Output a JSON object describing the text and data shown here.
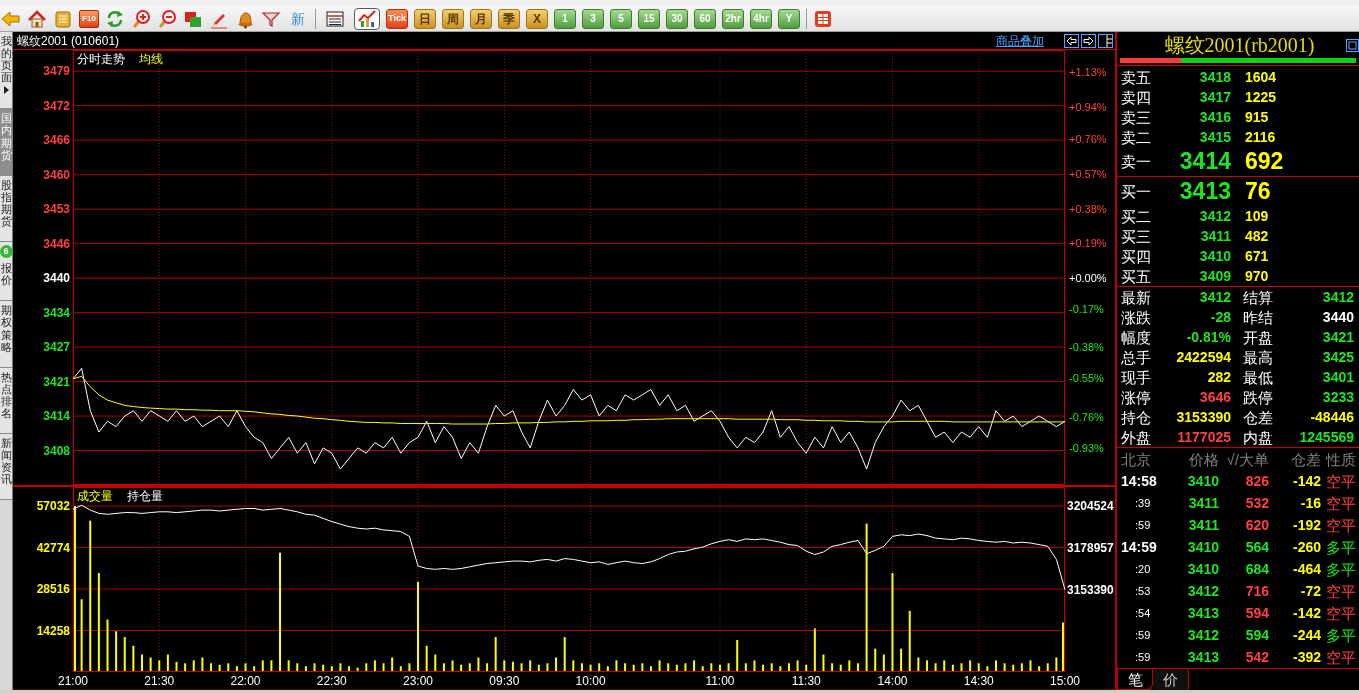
{
  "toolbar": {
    "f10_label": "F10",
    "news_button": "新",
    "views": [
      {
        "selected": false
      },
      {
        "selected": true
      }
    ],
    "periods": [
      {
        "label": "Tick",
        "kind": "tick"
      },
      {
        "label": "日",
        "kind": "calendar"
      },
      {
        "label": "周",
        "kind": "calendar"
      },
      {
        "label": "月",
        "kind": "calendar"
      },
      {
        "label": "季",
        "kind": "calendar"
      },
      {
        "label": "X",
        "kind": "calendar"
      },
      {
        "label": "1",
        "kind": "minute"
      },
      {
        "label": "3",
        "kind": "minute"
      },
      {
        "label": "5",
        "kind": "minute"
      },
      {
        "label": "15",
        "kind": "minute"
      },
      {
        "label": "30",
        "kind": "minute"
      },
      {
        "label": "60",
        "kind": "minute"
      },
      {
        "label": "2hr",
        "kind": "minute"
      },
      {
        "label": "4hr",
        "kind": "minute"
      },
      {
        "label": "Y",
        "kind": "minute"
      }
    ]
  },
  "sidebar": {
    "tabs": [
      {
        "label": "我的页面",
        "selected": false,
        "expandable": true
      },
      {
        "label": "国内期货",
        "selected": true,
        "expandable": false
      },
      {
        "label": "股指期货",
        "selected": false,
        "expandable": false
      },
      {
        "label": "报价",
        "selected": false,
        "expandable": false,
        "badge": "6"
      },
      {
        "label": "期权策略",
        "selected": false,
        "expandable": false
      },
      {
        "label": "热点排名",
        "selected": false,
        "expandable": false
      },
      {
        "label": "新闻资讯",
        "selected": false,
        "expandable": false
      }
    ]
  },
  "chart_panel": {
    "title": "螺纹2001 (010601)",
    "overlay_link": "商品叠加",
    "price_chart": {
      "chart_data": {
        "type": "line",
        "grid": true,
        "ylim": [
          3401,
          3483
        ],
        "yticks": [
          {
            "value": 3479,
            "label": "3479"
          },
          {
            "value": 3472.5,
            "label": "3472"
          },
          {
            "value": 3466,
            "label": "3466"
          },
          {
            "value": 3459.5,
            "label": "3460"
          },
          {
            "value": 3453,
            "label": "3453"
          },
          {
            "value": 3446.5,
            "label": "3446"
          },
          {
            "value": 3440,
            "label": "3440"
          },
          {
            "value": 3433.5,
            "label": "3434"
          },
          {
            "value": 3427,
            "label": "3427"
          },
          {
            "value": 3420.5,
            "label": "3421"
          },
          {
            "value": 3414,
            "label": "3414"
          },
          {
            "value": 3407.5,
            "label": "3408"
          }
        ],
        "y2lim": [
          -1.134,
          1.25
        ],
        "y2ticks": [
          {
            "value": 1.13,
            "label": "+1.13%"
          },
          {
            "value": 0.94,
            "label": "+0.94%"
          },
          {
            "value": 0.76,
            "label": "+0.76%"
          },
          {
            "value": 0.57,
            "label": "+0.57%"
          },
          {
            "value": 0.38,
            "label": "+0.38%"
          },
          {
            "value": 0.19,
            "label": "+0.19%"
          },
          {
            "value": 0,
            "label": "+0.00%"
          },
          {
            "value": -0.17,
            "label": "-0.17%"
          },
          {
            "value": -0.38,
            "label": "-0.38%"
          },
          {
            "value": -0.55,
            "label": "-0.55%"
          },
          {
            "value": -0.76,
            "label": "-0.76%"
          },
          {
            "value": -0.93,
            "label": "-0.93%"
          }
        ],
        "series": [
          {
            "name": "分时走势",
            "color": "#ffffff",
            "values": [
              3421,
              3423,
              3415,
              3411,
              3413,
              3412,
              3414,
              3415,
              3413,
              3415,
              3414,
              3413,
              3415,
              3413,
              3414,
              3412,
              3413,
              3414,
              3412,
              3415,
              3412,
              3410,
              3409,
              3406,
              3408,
              3410,
              3407,
              3409,
              3405,
              3408,
              3407,
              3404,
              3406,
              3408,
              3407,
              3409,
              3408,
              3410,
              3407,
              3409,
              3410,
              3413,
              3409,
              3412,
              3410,
              3406,
              3409,
              3407,
              3412,
              3416,
              3414,
              3415,
              3411,
              3408,
              3413,
              3417,
              3414,
              3416,
              3419,
              3417,
              3418,
              3414,
              3416,
              3415,
              3418,
              3417,
              3418,
              3419,
              3416,
              3418,
              3415,
              3416,
              3413,
              3414,
              3415,
              3413,
              3410,
              3408,
              3410,
              3409,
              3411,
              3415,
              3410,
              3412,
              3409,
              3407,
              3410,
              3408,
              3412,
              3409,
              3411,
              3408,
              3404,
              3409,
              3412,
              3414,
              3417,
              3415,
              3416,
              3413,
              3410,
              3411,
              3409,
              3411,
              3410,
              3412,
              3410,
              3415,
              3413,
              3414,
              3412,
              3413,
              3414,
              3413,
              3412,
              3413
            ]
          },
          {
            "name": "均线",
            "color": "#ffff00",
            "values": [
              3421,
              3421.5,
              3419.5,
              3418,
              3417,
              3416.5,
              3416,
              3415.8,
              3415.6,
              3415.5,
              3415.4,
              3415.3,
              3415.3,
              3415.2,
              3415.2,
              3415.1,
              3415.1,
              3415,
              3415,
              3415,
              3414.9,
              3414.8,
              3414.6,
              3414.4,
              3414.3,
              3414.1,
              3414,
              3413.8,
              3413.6,
              3413.5,
              3413.3,
              3413.2,
              3413,
              3412.9,
              3412.8,
              3412.8,
              3412.7,
              3412.7,
              3412.6,
              3412.6,
              3412.6,
              3412.6,
              3412.6,
              3412.6,
              3412.5,
              3412.5,
              3412.5,
              3412.5,
              3412.5,
              3412.6,
              3412.6,
              3412.7,
              3412.7,
              3412.7,
              3412.8,
              3412.8,
              3412.9,
              3412.9,
              3413,
              3413,
              3413.1,
              3413.1,
              3413.1,
              3413.2,
              3413.2,
              3413.3,
              3413.3,
              3413.4,
              3413.4,
              3413.5,
              3413.5,
              3413.5,
              3413.5,
              3413.5,
              3413.5,
              3413.5,
              3413.5,
              3413.4,
              3413.4,
              3413.4,
              3413.4,
              3413.4,
              3413.3,
              3413.3,
              3413.3,
              3413.2,
              3413.2,
              3413.1,
              3413.1,
              3413.1,
              3413,
              3413,
              3412.9,
              3412.9,
              3412.9,
              3412.9,
              3413,
              3413,
              3413,
              3413,
              3413,
              3413,
              3412.9,
              3412.9,
              3412.9,
              3412.9,
              3412.9,
              3412.9,
              3412.9,
              3412.9,
              3412.9,
              3412.9,
              3412.9,
              3412.9,
              3412.9,
              3412.9
            ]
          }
        ]
      }
    },
    "volume_chart": {
      "chart_data": {
        "type": "bar",
        "grid": true,
        "categories": [
          "21:00",
          null,
          null,
          null,
          null,
          null,
          null,
          null,
          null,
          null,
          "21:30",
          null,
          null,
          null,
          null,
          null,
          null,
          null,
          null,
          null,
          "22:00",
          null,
          null,
          null,
          null,
          null,
          null,
          null,
          null,
          null,
          "22:30",
          null,
          null,
          null,
          null,
          null,
          null,
          null,
          null,
          null,
          "23:00",
          null,
          null,
          null,
          null,
          null,
          null,
          null,
          null,
          null,
          "09:30",
          null,
          null,
          null,
          null,
          null,
          null,
          null,
          null,
          null,
          "10:00",
          null,
          null,
          null,
          null,
          null,
          null,
          null,
          null,
          null,
          null,
          null,
          null,
          null,
          null,
          "11:00",
          null,
          null,
          null,
          null,
          null,
          null,
          null,
          null,
          null,
          "11:30",
          null,
          null,
          null,
          null,
          null,
          null,
          null,
          null,
          null,
          "14:00",
          null,
          null,
          null,
          null,
          null,
          null,
          null,
          null,
          null,
          "14:30",
          null,
          null,
          null,
          null,
          null,
          null,
          null,
          null,
          null,
          "15:00"
        ],
        "ylim": [
          0,
          63560
        ],
        "yticks": [
          14258,
          28516,
          42774,
          57032
        ],
        "y2lim": [
          3103477,
          3216089
        ],
        "y2ticks": [
          3153390,
          3178957,
          3204524
        ],
        "series": [
          {
            "name": "成交量",
            "color": "#ffff00",
            "values": [
              57000,
              25000,
              52000,
              34000,
              18000,
              14000,
              12000,
              9000,
              6000,
              5000,
              4000,
              6000,
              3500,
              3000,
              4000,
              5000,
              3000,
              2500,
              3000,
              2000,
              3000,
              2000,
              4000,
              4000,
              41000,
              4000,
              3000,
              2000,
              3000,
              2500,
              2000,
              3000,
              2000,
              1500,
              3000,
              4000,
              3000,
              5000,
              2000,
              3000,
              31000,
              9000,
              6000,
              3000,
              4000,
              2500,
              3000,
              5000,
              3000,
              12000,
              4000,
              3500,
              3000,
              4000,
              2500,
              3000,
              5000,
              12000,
              4000,
              3000,
              2500,
              3000,
              2000,
              4000,
              3000,
              2500,
              3000,
              2000,
              4000,
              3000,
              2500,
              3000,
              4000,
              2000,
              3000,
              2500,
              3000,
              11000,
              3000,
              4000,
              2500,
              3000,
              2000,
              3000,
              4000,
              2500,
              15000,
              6000,
              3000,
              2500,
              4000,
              3000,
              51000,
              8000,
              6000,
              34000,
              8000,
              21000,
              5000,
              4000,
              3000,
              4000,
              2500,
              3000,
              4000,
              3000,
              2000,
              4000,
              3000,
              2500,
              3000,
              4000,
              2000,
              3000,
              5000,
              17000
            ]
          },
          {
            "name": "持仓量",
            "color": "#ffffff",
            "type": "line",
            "axis": "y2",
            "values": [
              3202500,
              3205000,
              3202000,
              3200000,
              3199500,
              3200000,
              3200500,
              3200500,
              3200000,
              3200500,
              3201000,
              3201000,
              3200500,
              3201000,
              3201500,
              3202000,
              3202000,
              3201500,
              3202000,
              3202500,
              3203000,
              3203000,
              3202000,
              3202500,
              3203000,
              3202000,
              3201000,
              3199500,
              3199000,
              3197000,
              3195000,
              3193500,
              3192000,
              3191000,
              3190500,
              3191000,
              3190000,
              3189500,
              3189000,
              3186000,
              3168000,
              3166500,
              3166000,
              3166500,
              3166000,
              3166500,
              3167500,
              3168500,
              3169500,
              3170000,
              3170500,
              3171000,
              3171000,
              3170500,
              3171500,
              3172000,
              3171000,
              3172500,
              3172000,
              3171000,
              3170000,
              3170500,
              3169000,
              3170000,
              3171000,
              3170000,
              3169500,
              3170500,
              3172500,
              3175000,
              3176500,
              3177000,
              3178500,
              3179500,
              3181500,
              3183000,
              3184000,
              3183000,
              3184500,
              3184000,
              3184500,
              3183500,
              3182500,
              3181000,
              3180500,
              3177000,
              3175000,
              3176500,
              3180000,
              3181000,
              3182500,
              3183500,
              3175500,
              3177500,
              3180000,
              3186000,
              3187000,
              3186500,
              3187500,
              3186500,
              3185000,
              3184500,
              3184000,
              3185000,
              3184500,
              3183500,
              3183000,
              3182500,
              3183000,
              3182000,
              3182500,
              3182000,
              3181000,
              3180000,
              3172000,
              3153500
            ]
          }
        ]
      }
    }
  },
  "quote_panel": {
    "title": "螺纹2001(rb2001)",
    "ratio_bar": {
      "level": 0.26
    },
    "asks": [
      {
        "label": "卖五",
        "price": "3418",
        "volume": "1604",
        "kind": "level"
      },
      {
        "label": "卖四",
        "price": "3417",
        "volume": "1225",
        "kind": "level"
      },
      {
        "label": "卖三",
        "price": "3416",
        "volume": "915",
        "kind": "level"
      },
      {
        "label": "卖二",
        "price": "3415",
        "volume": "2116",
        "kind": "level"
      },
      {
        "label": "卖一",
        "price": "3414",
        "volume": "692",
        "kind": "best"
      }
    ],
    "bids": [
      {
        "label": "买一",
        "price": "3413",
        "volume": "76",
        "kind": "best"
      },
      {
        "label": "买二",
        "price": "3412",
        "volume": "109",
        "kind": "level"
      },
      {
        "label": "买三",
        "price": "3411",
        "volume": "482",
        "kind": "level"
      },
      {
        "label": "买四",
        "price": "3410",
        "volume": "671",
        "kind": "level"
      },
      {
        "label": "买五",
        "price": "3409",
        "volume": "970",
        "kind": "level"
      }
    ],
    "stats": [
      {
        "label": "最新",
        "value": "3412",
        "color": "#1ee61e"
      },
      {
        "label": "结算",
        "value": "3412",
        "color": "#1ee61e"
      },
      {
        "label": "涨跌",
        "value": "-28",
        "color": "#1ee61e"
      },
      {
        "label": "昨结",
        "value": "3440",
        "color": "#ffffff"
      },
      {
        "label": "幅度",
        "value": "-0.81%",
        "color": "#1ee61e"
      },
      {
        "label": "开盘",
        "value": "3421",
        "color": "#1ee61e"
      },
      {
        "label": "总手",
        "value": "2422594",
        "color": "#ffff00"
      },
      {
        "label": "最高",
        "value": "3425",
        "color": "#1ee61e"
      },
      {
        "label": "现手",
        "value": "282",
        "color": "#ffff00"
      },
      {
        "label": "最低",
        "value": "3401",
        "color": "#1ee61e"
      },
      {
        "label": "涨停",
        "value": "3646",
        "color": "#ff4040"
      },
      {
        "label": "跌停",
        "value": "3233",
        "color": "#1ee61e"
      },
      {
        "label": "持仓",
        "value": "3153390",
        "color": "#ffff00"
      },
      {
        "label": "仓差",
        "value": "-48446",
        "color": "#ffff00"
      },
      {
        "label": "外盘",
        "value": "1177025",
        "color": "#ff4040"
      },
      {
        "label": "内盘",
        "value": "1245569",
        "color": "#1ee61e"
      }
    ],
    "ticks": {
      "columns": [
        "北京",
        "价格",
        "√/大单",
        "仓差",
        "性质"
      ],
      "rows": [
        {
          "time": "14:58",
          "kind": "full",
          "price": "3410",
          "volume": "826",
          "oi_change": "-142",
          "nature": "空平",
          "color": "#ff4040"
        },
        {
          "time": ":39",
          "kind": "seconds",
          "price": "3411",
          "volume": "532",
          "oi_change": "-16",
          "nature": "空平",
          "color": "#ff4040"
        },
        {
          "time": ":59",
          "kind": "seconds",
          "price": "3411",
          "volume": "620",
          "oi_change": "-192",
          "nature": "空平",
          "color": "#ff4040"
        },
        {
          "time": "14:59",
          "kind": "full",
          "price": "3410",
          "volume": "564",
          "oi_change": "-260",
          "nature": "多平",
          "color": "#1ee61e"
        },
        {
          "time": ":20",
          "kind": "seconds",
          "price": "3410",
          "volume": "684",
          "oi_change": "-464",
          "nature": "多平",
          "color": "#1ee61e"
        },
        {
          "time": ":53",
          "kind": "seconds",
          "price": "3412",
          "volume": "716",
          "oi_change": "-72",
          "nature": "空平",
          "color": "#ff4040"
        },
        {
          "time": ":54",
          "kind": "seconds",
          "price": "3413",
          "volume": "594",
          "oi_change": "-142",
          "nature": "空平",
          "color": "#ff4040"
        },
        {
          "time": ":59",
          "kind": "seconds",
          "price": "3412",
          "volume": "594",
          "oi_change": "-244",
          "nature": "多平",
          "color": "#1ee61e"
        },
        {
          "time": ":59",
          "kind": "seconds",
          "price": "3413",
          "volume": "542",
          "oi_change": "-392",
          "nature": "空平",
          "color": "#ff4040"
        }
      ]
    },
    "tabs": [
      {
        "label": "笔",
        "selected": true
      },
      {
        "label": "价",
        "selected": false
      }
    ]
  }
}
